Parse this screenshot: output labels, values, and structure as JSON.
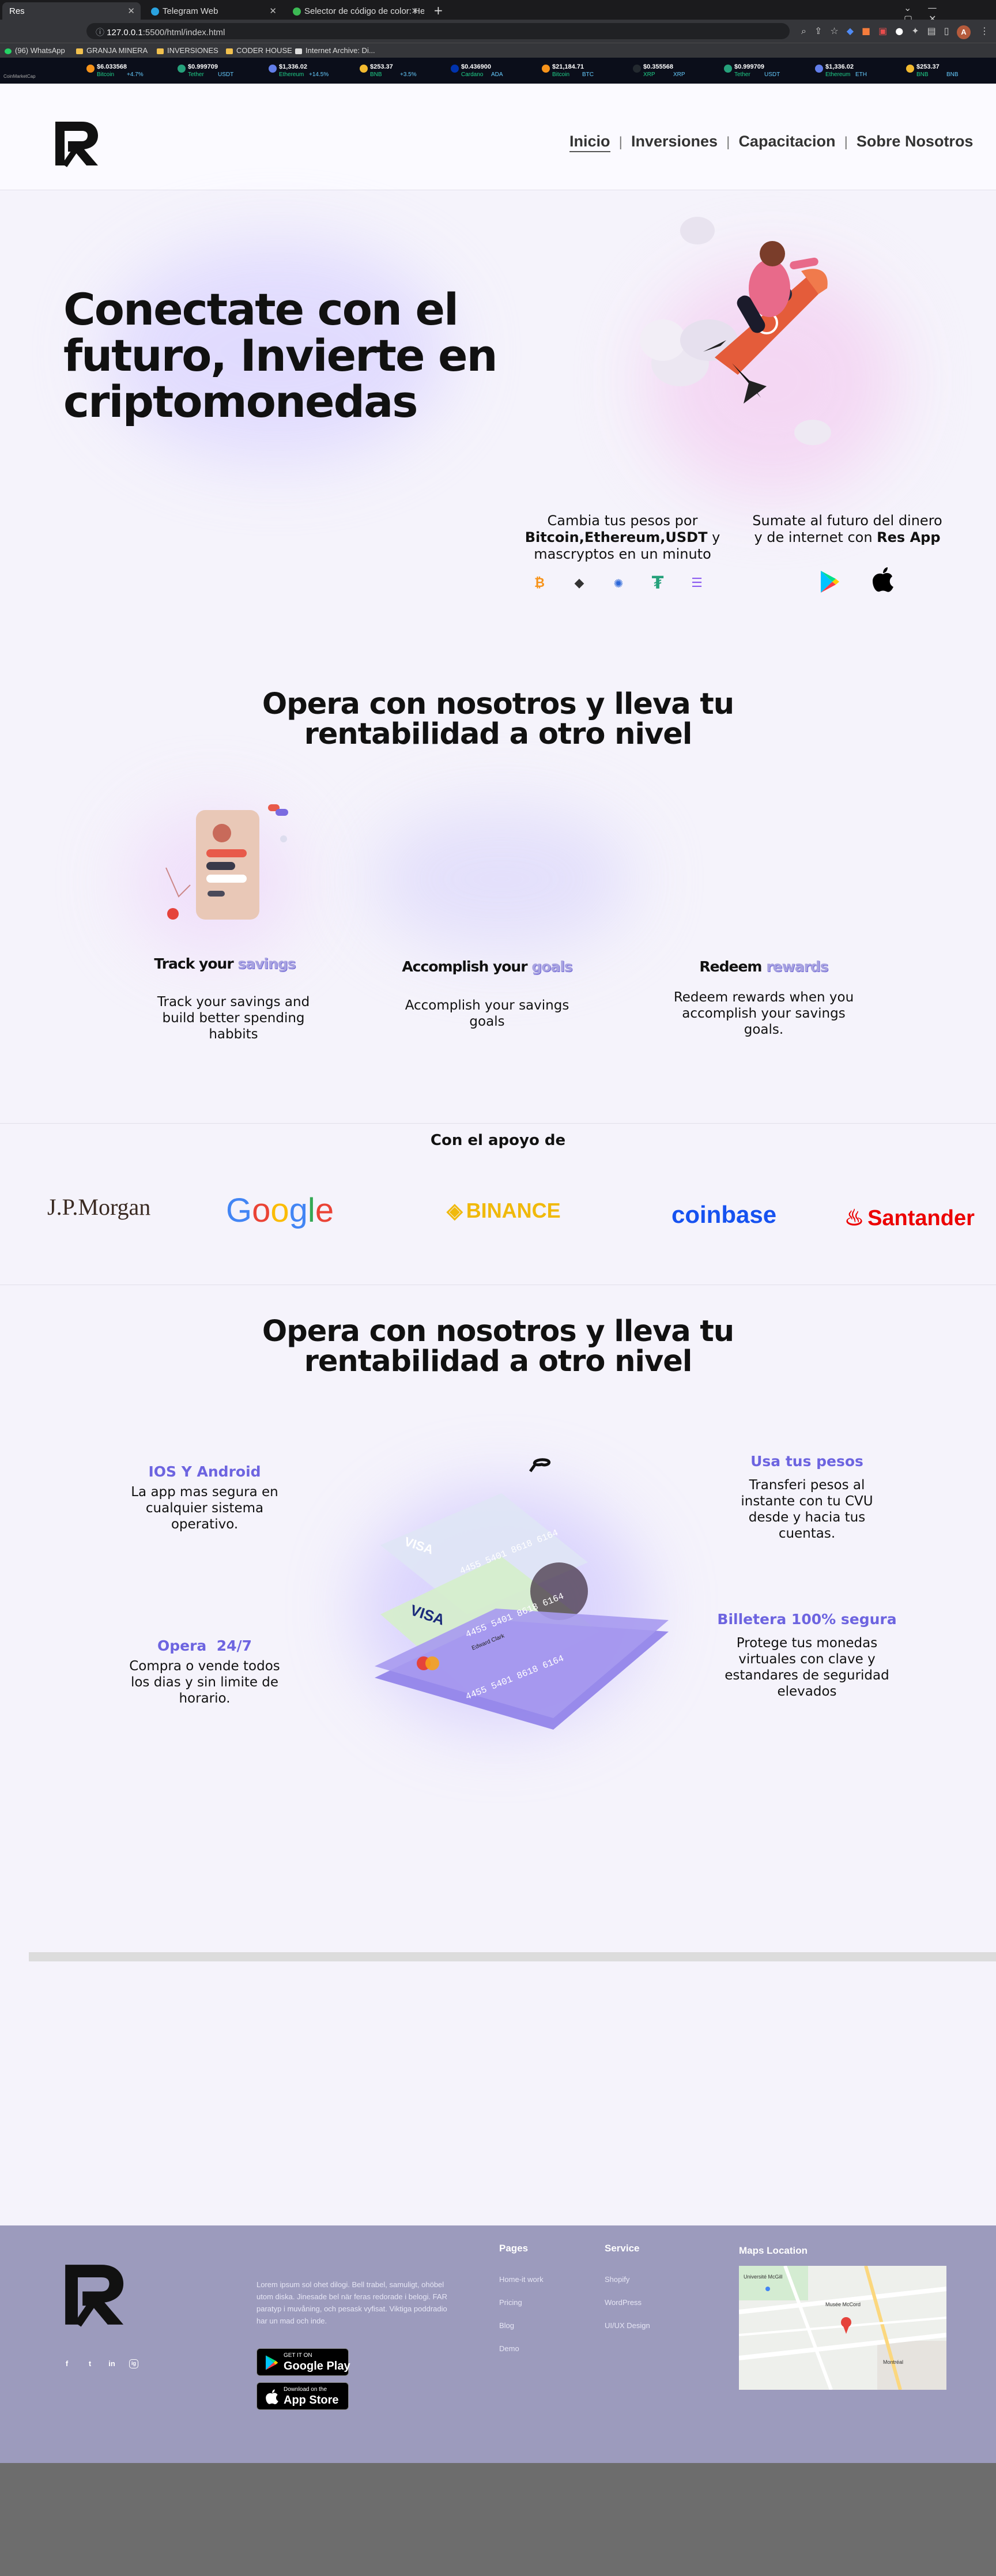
{
  "browser": {
    "tabs": [
      {
        "label": "Res",
        "active": true
      },
      {
        "label": "Telegram Web",
        "active": false
      },
      {
        "label": "Selector de código de color: He...",
        "active": false
      }
    ],
    "new_tab": "+",
    "url_host": "127.0.0.1",
    "url_path": ":5500/html/index.html",
    "bookmarks": [
      "(96) WhatsApp",
      "GRANJA MINERA",
      "INVERSIONES",
      "CODER HOUSE",
      "Internet Archive: Di..."
    ],
    "profile_initial": "A",
    "ticker_brand": "CoinMarketCap",
    "ticker": [
      {
        "name": "Bitcoin",
        "price": "$6.033568",
        "change": "+4.7%",
        "color": "#f7931a"
      },
      {
        "name": "Tether",
        "price": "$0.999709",
        "change": "USDT",
        "color": "#26a17b"
      },
      {
        "name": "Ethereum",
        "price": "$1,336.02",
        "change": "+14.5%",
        "color": "#627eea"
      },
      {
        "name": "BNB",
        "price": "$253.37",
        "change": "+3.5%",
        "color": "#f3ba2f"
      },
      {
        "name": "Cardano",
        "price": "$0.436900",
        "color": "#0033ad",
        "change": "ADA"
      },
      {
        "name": "Bitcoin",
        "price": "$21,184.71",
        "change": "BTC",
        "color": "#f7931a"
      },
      {
        "name": "XRP",
        "price": "$0.355568",
        "change": "XRP",
        "color": "#23292f"
      },
      {
        "name": "Tether",
        "price": "$0.999709",
        "change": "USDT",
        "color": "#26a17b"
      },
      {
        "name": "Ethereum",
        "price": "$1,336.02",
        "change": "ETH",
        "color": "#627eea"
      },
      {
        "name": "BNB",
        "price": "$253.37",
        "change": "BNB",
        "color": "#f3ba2f"
      }
    ]
  },
  "nav": {
    "items": [
      "Inicio",
      "Inversiones",
      "Capacitacion",
      "Sobre Nosotros"
    ],
    "separator": "|"
  },
  "hero": {
    "title_line1": "Conectate con el",
    "title_line2": "futuro, Invierte en",
    "title_line3": "criptomonedas",
    "left_text_a": "Cambia tus pesos por",
    "left_text_b": "Bitcoin,Ethereum,USDT",
    "left_text_c": " y",
    "left_text_d": "mascryptos en un minuto",
    "right_text_a": "Sumate al futuro del dinero",
    "right_text_b": "y de internet con ",
    "right_text_c": "Res App",
    "coins": [
      "bitcoin-icon",
      "ethereum-icon",
      "cardano-icon",
      "tether-icon",
      "solana-icon"
    ]
  },
  "section1": {
    "title_line1": "Opera con nosotros y lleva tu",
    "title_line2": "rentabilidad a otro nivel",
    "features": [
      {
        "title_a": "Track your ",
        "title_b": "savings",
        "desc": [
          "Track your savings and",
          "build better spending",
          "habbits"
        ]
      },
      {
        "title_a": "Accomplish your ",
        "title_b": "goals",
        "desc": [
          "Accomplish your savings",
          "goals"
        ]
      },
      {
        "title_a": "Redeem ",
        "title_b": "rewards",
        "desc": [
          "Redeem rewards when you",
          "accomplish your savings",
          "goals."
        ]
      }
    ]
  },
  "partners": {
    "title": "Con el apoyo de",
    "logos": [
      "J.P.Morgan",
      "Google",
      "BINANCE",
      "coinbase",
      "Santander"
    ]
  },
  "section2": {
    "title_line1": "Opera con nosotros y lleva tu",
    "title_line2": "rentabilidad a otro nivel",
    "f1_title": "IOS Y Android",
    "f1_desc": [
      "La app mas segura en",
      "cualquier sistema",
      "operativo."
    ],
    "f2_title": "Opera  24/7",
    "f2_desc": [
      "Compra o vende todos",
      "los dias y sin limite de",
      "horario."
    ],
    "f3_title": "Usa tus pesos",
    "f3_desc": [
      "Transferi pesos al",
      "instante con tu CVU",
      "desde y hacia tus",
      "cuentas."
    ],
    "f4_title": "Billetera 100% segura",
    "f4_desc": [
      "Protege tus monedas",
      "virtuales con clave y",
      "estandares de seguridad",
      "elevados"
    ],
    "card_number": "4455 5401 8618 6164",
    "card_brand": "VISA",
    "card_holder": "Edward Clark"
  },
  "footer": {
    "about": [
      "Lorem ipsum sol ohet dilogi. Bell trabel, samuligt, ohöbel",
      "utom diska. Jinesade bel när feras redorade i belogi. FAR",
      "paratyp i muvåning, och pesask vyfisat. Viktiga poddradio",
      "har un mad och inde."
    ],
    "google_play_small": "GET IT ON",
    "google_play": "Google Play",
    "app_store_small": "Download on the",
    "app_store": "App Store",
    "pages_title": "Pages",
    "pages": [
      "Home-it work",
      "Pricing",
      "Blog",
      "Demo"
    ],
    "service_title": "Service",
    "services": [
      "Shopify",
      "WordPress",
      "UI/UX Design"
    ],
    "map_title": "Maps Location",
    "map_labels": [
      "Université McGill",
      "Musée McCord",
      "Montréal"
    ],
    "social": [
      "f",
      "t",
      "in",
      "ig"
    ]
  },
  "colors": {
    "accent": "#6d64e0",
    "footer_bg": "#9c9bbd",
    "page_bg": "#f5f3fb"
  }
}
